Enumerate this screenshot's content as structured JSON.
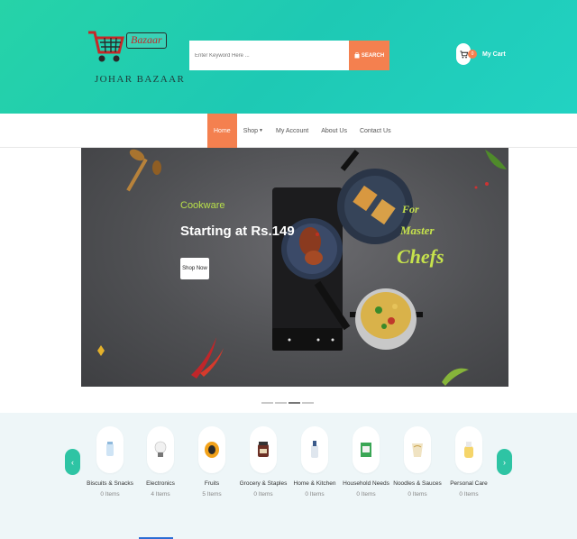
{
  "header": {
    "logo_tag": "Bazaar",
    "logo_text": "JOHAR BAZAAR",
    "search_placeholder": "Enter Keyword Here ...",
    "search_button": "SEARCH",
    "search_icon": "bag-icon",
    "cart_count": "0",
    "cart_label": "My Cart",
    "colors": {
      "header_start": "#26d3a8",
      "header_end": "#22d2c2",
      "accent": "#f4804f"
    }
  },
  "nav": {
    "items": [
      {
        "label": "Home",
        "active": true
      },
      {
        "label": "Shop",
        "dropdown": true
      },
      {
        "label": "My Account"
      },
      {
        "label": "About Us"
      },
      {
        "label": "Contact Us"
      }
    ]
  },
  "banner": {
    "subtitle": "Cookware",
    "title": "Starting at Rs.149",
    "button": "Shop Now",
    "badge_line1": "For",
    "badge_line2": "Master",
    "badge_line3": "Chefs",
    "slides": 4,
    "active_slide": 3
  },
  "categories": {
    "prev_icon": "chevron-left-icon",
    "next_icon": "chevron-right-icon",
    "items": [
      {
        "name": "Biscuits & Snacks",
        "count": "0 Items",
        "icon": "snack-jar-icon"
      },
      {
        "name": "Electronics",
        "count": "4 Items",
        "icon": "bulb-icon"
      },
      {
        "name": "Fruits",
        "count": "5 Items",
        "icon": "papaya-icon"
      },
      {
        "name": "Grocery & Staples",
        "count": "0 Items",
        "icon": "grocery-jar-icon"
      },
      {
        "name": "Home & Kitchen",
        "count": "0 Items",
        "icon": "kitchen-bottle-icon"
      },
      {
        "name": "Household Needs",
        "count": "0 Items",
        "icon": "cleaner-box-icon"
      },
      {
        "name": "Noodles & Sauces",
        "count": "0 Items",
        "icon": "noodles-pack-icon"
      },
      {
        "name": "Personal Care",
        "count": "0 Items",
        "icon": "cream-bottle-icon"
      }
    ]
  }
}
